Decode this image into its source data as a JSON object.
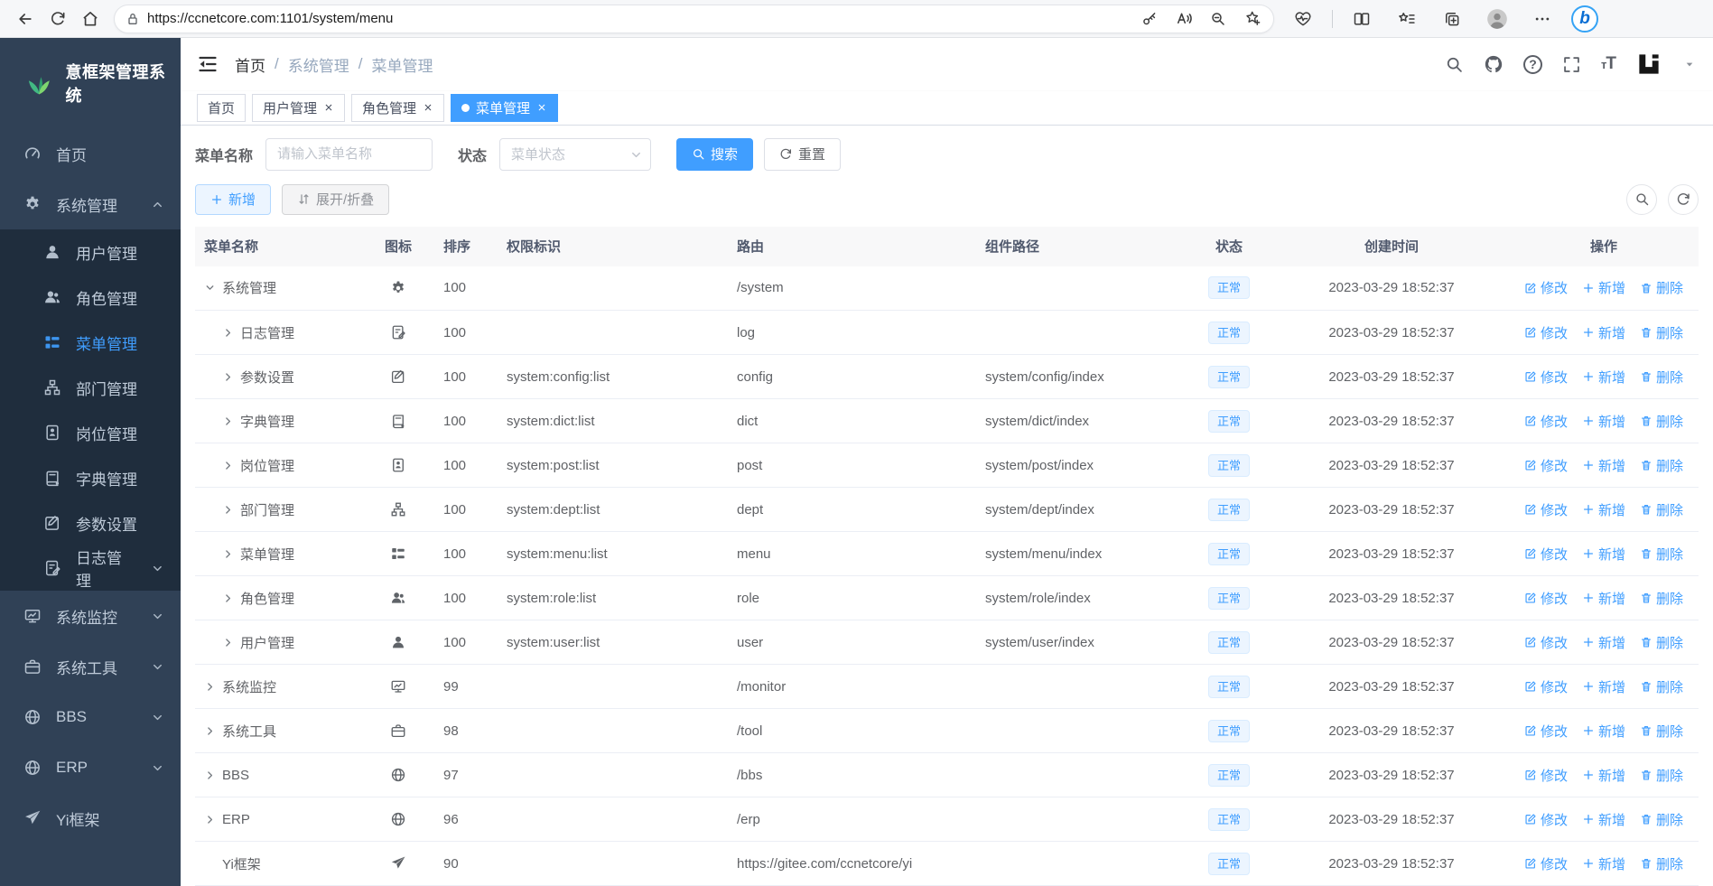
{
  "browser": {
    "url": "https://ccnetcore.com:1101/system/menu",
    "left_icons": [
      "back",
      "refresh",
      "home"
    ],
    "pill_icons": [
      "lock",
      "key",
      "read-aloud",
      "zoom-out",
      "favorite-add"
    ],
    "right_icons": [
      "browser-essentials",
      "split-screen",
      "favorites-bar",
      "collections",
      "profile",
      "more",
      "bing"
    ]
  },
  "sidebar": {
    "logo_text": "意框架管理系统",
    "items": [
      {
        "label": "首页",
        "icon": "dashboard",
        "sub": false
      },
      {
        "label": "系统管理",
        "icon": "gear",
        "sub": false,
        "chevron": "up"
      },
      {
        "label": "用户管理",
        "icon": "user",
        "sub": true
      },
      {
        "label": "角色管理",
        "icon": "users",
        "sub": true
      },
      {
        "label": "菜单管理",
        "icon": "list",
        "sub": true,
        "active": true
      },
      {
        "label": "部门管理",
        "icon": "tree",
        "sub": true
      },
      {
        "label": "岗位管理",
        "icon": "badge",
        "sub": true
      },
      {
        "label": "字典管理",
        "icon": "book",
        "sub": true
      },
      {
        "label": "参数设置",
        "icon": "pen-square",
        "sub": true
      },
      {
        "label": "日志管理",
        "icon": "doc-edit",
        "sub": true,
        "chevron": "down"
      },
      {
        "label": "系统监控",
        "icon": "monitor",
        "sub": false,
        "chevron": "down"
      },
      {
        "label": "系统工具",
        "icon": "briefcase",
        "sub": false,
        "chevron": "down"
      },
      {
        "label": "BBS",
        "icon": "globe",
        "sub": false,
        "chevron": "down"
      },
      {
        "label": "ERP",
        "icon": "globe",
        "sub": false,
        "chevron": "down"
      },
      {
        "label": "Yi框架",
        "icon": "send",
        "sub": false
      }
    ]
  },
  "navbar": {
    "breadcrumbs": [
      "首页",
      "系统管理",
      "菜单管理"
    ]
  },
  "tabs": [
    {
      "label": "首页",
      "active": false,
      "closable": false,
      "dot": false
    },
    {
      "label": "用户管理",
      "active": false,
      "closable": true,
      "dot": false
    },
    {
      "label": "角色管理",
      "active": false,
      "closable": true,
      "dot": false
    },
    {
      "label": "菜单管理",
      "active": true,
      "closable": true,
      "dot": true
    }
  ],
  "search": {
    "name_label": "菜单名称",
    "name_placeholder": "请输入菜单名称",
    "status_label": "状态",
    "status_placeholder": "菜单状态",
    "search_button": "搜索",
    "reset_button": "重置"
  },
  "toolbar": {
    "add_button": "新增",
    "expand_button": "展开/折叠"
  },
  "table": {
    "columns": [
      "菜单名称",
      "图标",
      "排序",
      "权限标识",
      "路由",
      "组件路径",
      "状态",
      "创建时间",
      "操作"
    ],
    "action_labels": {
      "edit": "修改",
      "add": "新增",
      "delete": "删除"
    },
    "rows": [
      {
        "name": "系统管理",
        "icon": "gear",
        "arrow": "down",
        "child": false,
        "sort": "100",
        "perms": "",
        "route": "/system",
        "component": "",
        "status": "正常",
        "created": "2023-03-29 18:52:37"
      },
      {
        "name": "日志管理",
        "icon": "doc-edit",
        "arrow": "right",
        "child": true,
        "sort": "100",
        "perms": "",
        "route": "log",
        "component": "",
        "status": "正常",
        "created": "2023-03-29 18:52:37"
      },
      {
        "name": "参数设置",
        "icon": "pen-square",
        "arrow": "right",
        "child": true,
        "sort": "100",
        "perms": "system:config:list",
        "route": "config",
        "component": "system/config/index",
        "status": "正常",
        "created": "2023-03-29 18:52:37"
      },
      {
        "name": "字典管理",
        "icon": "book",
        "arrow": "right",
        "child": true,
        "sort": "100",
        "perms": "system:dict:list",
        "route": "dict",
        "component": "system/dict/index",
        "status": "正常",
        "created": "2023-03-29 18:52:37"
      },
      {
        "name": "岗位管理",
        "icon": "badge",
        "arrow": "right",
        "child": true,
        "sort": "100",
        "perms": "system:post:list",
        "route": "post",
        "component": "system/post/index",
        "status": "正常",
        "created": "2023-03-29 18:52:37"
      },
      {
        "name": "部门管理",
        "icon": "tree",
        "arrow": "right",
        "child": true,
        "sort": "100",
        "perms": "system:dept:list",
        "route": "dept",
        "component": "system/dept/index",
        "status": "正常",
        "created": "2023-03-29 18:52:37"
      },
      {
        "name": "菜单管理",
        "icon": "list",
        "arrow": "right",
        "child": true,
        "sort": "100",
        "perms": "system:menu:list",
        "route": "menu",
        "component": "system/menu/index",
        "status": "正常",
        "created": "2023-03-29 18:52:37"
      },
      {
        "name": "角色管理",
        "icon": "users",
        "arrow": "right",
        "child": true,
        "sort": "100",
        "perms": "system:role:list",
        "route": "role",
        "component": "system/role/index",
        "status": "正常",
        "created": "2023-03-29 18:52:37"
      },
      {
        "name": "用户管理",
        "icon": "user",
        "arrow": "right",
        "child": true,
        "sort": "100",
        "perms": "system:user:list",
        "route": "user",
        "component": "system/user/index",
        "status": "正常",
        "created": "2023-03-29 18:52:37"
      },
      {
        "name": "系统监控",
        "icon": "monitor",
        "arrow": "right",
        "child": false,
        "sort": "99",
        "perms": "",
        "route": "/monitor",
        "component": "",
        "status": "正常",
        "created": "2023-03-29 18:52:37"
      },
      {
        "name": "系统工具",
        "icon": "briefcase",
        "arrow": "right",
        "child": false,
        "sort": "98",
        "perms": "",
        "route": "/tool",
        "component": "",
        "status": "正常",
        "created": "2023-03-29 18:52:37"
      },
      {
        "name": "BBS",
        "icon": "globe",
        "arrow": "right",
        "child": false,
        "sort": "97",
        "perms": "",
        "route": "/bbs",
        "component": "",
        "status": "正常",
        "created": "2023-03-29 18:52:37"
      },
      {
        "name": "ERP",
        "icon": "globe",
        "arrow": "right",
        "child": false,
        "sort": "96",
        "perms": "",
        "route": "/erp",
        "component": "",
        "status": "正常",
        "created": "2023-03-29 18:52:37"
      },
      {
        "name": "Yi框架",
        "icon": "send",
        "arrow": "none",
        "child": false,
        "sort": "90",
        "perms": "",
        "route": "https://gitee.com/ccnetcore/yi",
        "component": "",
        "status": "正常",
        "created": "2023-03-29 18:52:37"
      }
    ]
  },
  "colors": {
    "accent": "#409eff",
    "sidebar_bg": "#304156",
    "sidebar_submenu_bg": "#1f2d3d",
    "sidebar_text": "#bfcbd9",
    "status_badge_bg": "#ecf5ff",
    "status_badge_border": "#d9ecff",
    "active_tab_bg": "#409eff",
    "logo_green": "#42b983"
  }
}
